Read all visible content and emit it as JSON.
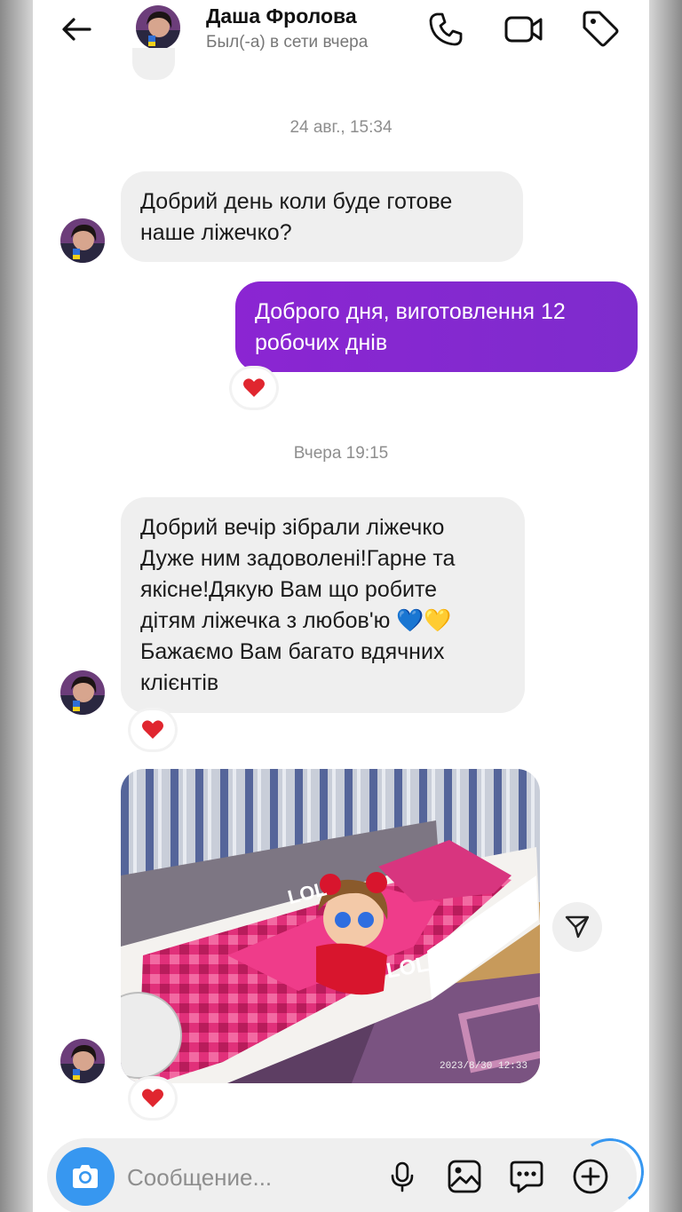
{
  "header": {
    "contact_name": "Даша Фролова",
    "status": "Был(-а) в сети вчера",
    "icons": [
      "arrow-left-icon",
      "phone-icon",
      "video-icon",
      "tag-icon"
    ]
  },
  "messages": {
    "timestamp_1": "24 авг., 15:34",
    "incoming_1": [
      "Добрий день коли буде готове",
      "наше ліжечко?"
    ],
    "outgoing_1": [
      "Доброго дня, виготовлення 12",
      "робочих днів"
    ],
    "outgoing_1_reaction": "heart",
    "timestamp_2": "Вчера 19:15",
    "incoming_2": [
      "Добрий вечір зібрали ліжечко",
      "Дуже ним задоволені!Гарне та",
      "якісне!Дякую Вам що робите",
      "дітям ліжечка з любов'ю 💙💛",
      "Бажаємо Вам багато вдячних",
      "клієнтів"
    ],
    "incoming_2_reaction": "heart",
    "photo_stamp": "2023/8/30  12:33",
    "photo_reaction": "heart"
  },
  "composer": {
    "placeholder": "Сообщение...",
    "icons": [
      "camera-icon",
      "microphone-icon",
      "gallery-icon",
      "sticker-icon",
      "plus-icon"
    ]
  },
  "colors": {
    "outgoing_bubble": "#8b25d2",
    "incoming_bubble": "#efefef",
    "accent_blue": "#3797f0",
    "reaction_heart": "#e0262f"
  }
}
